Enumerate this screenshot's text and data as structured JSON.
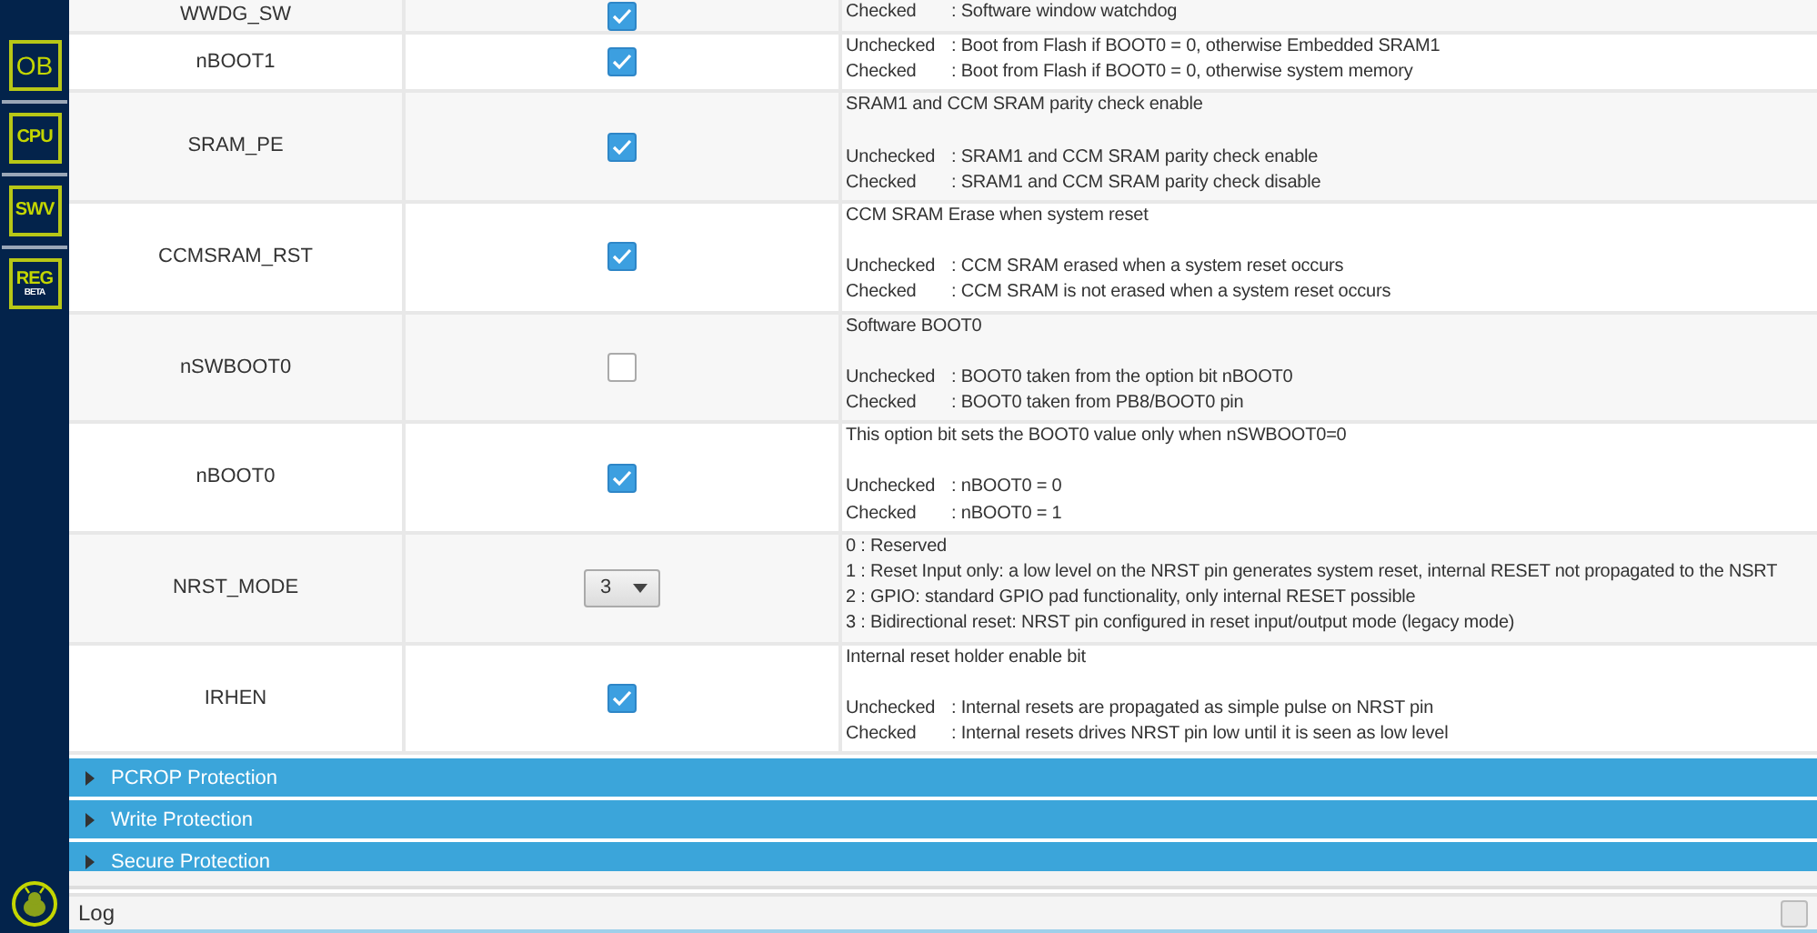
{
  "sidebar": {
    "items": [
      {
        "label": "OB"
      },
      {
        "label": "CPU"
      },
      {
        "label": "SWV"
      },
      {
        "label": "REG",
        "sub": "BETA"
      }
    ]
  },
  "option_bytes": {
    "rows": [
      {
        "name": "WWDG_SW",
        "control": {
          "kind": "checkbox",
          "checked": true
        },
        "options": [
          {
            "key": "Checked",
            "value": ": Software window watchdog"
          }
        ]
      },
      {
        "name": "nBOOT1",
        "control": {
          "kind": "checkbox",
          "checked": true
        },
        "options": [
          {
            "key": "Unchecked",
            "value": ": Boot from Flash if BOOT0 = 0, otherwise Embedded SRAM1"
          },
          {
            "key": "Checked",
            "value": ": Boot from Flash if BOOT0 = 0, otherwise system memory"
          }
        ]
      },
      {
        "name": "SRAM_PE",
        "control": {
          "kind": "checkbox",
          "checked": true
        },
        "title": "SRAM1 and CCM SRAM parity check enable",
        "options": [
          {
            "key": "Unchecked",
            "value": ": SRAM1 and CCM SRAM parity check enable"
          },
          {
            "key": "Checked",
            "value": ": SRAM1 and CCM SRAM parity check disable"
          }
        ]
      },
      {
        "name": "CCMSRAM_RST",
        "control": {
          "kind": "checkbox",
          "checked": true
        },
        "title": "CCM SRAM Erase when system reset",
        "options": [
          {
            "key": "Unchecked",
            "value": ": CCM SRAM erased when a system reset occurs"
          },
          {
            "key": "Checked",
            "value": ": CCM SRAM is not erased when a system reset occurs"
          }
        ]
      },
      {
        "name": "nSWBOOT0",
        "control": {
          "kind": "checkbox",
          "checked": false
        },
        "title": "Software BOOT0",
        "options": [
          {
            "key": "Unchecked",
            "value": ": BOOT0 taken from the option bit nBOOT0"
          },
          {
            "key": "Checked",
            "value": ": BOOT0 taken from PB8/BOOT0 pin"
          }
        ]
      },
      {
        "name": "nBOOT0",
        "control": {
          "kind": "checkbox",
          "checked": true
        },
        "title": "This option bit sets the BOOT0 value only when nSWBOOT0=0",
        "options": [
          {
            "key": "Unchecked",
            "value": ": nBOOT0 = 0"
          },
          {
            "key": "Checked",
            "value": ": nBOOT0 = 1"
          }
        ]
      },
      {
        "name": "NRST_MODE",
        "control": {
          "kind": "select",
          "value": "3"
        },
        "options": [
          {
            "key": "0",
            "value": ": Reserved"
          },
          {
            "key": "1",
            "value": ": Reset Input only: a low level on the NRST pin generates system reset, internal RESET not propagated to the NSRT"
          },
          {
            "key": "2",
            "value": ": GPIO: standard GPIO pad functionality, only internal RESET possible"
          },
          {
            "key": "3",
            "value": ": Bidirectional reset: NRST pin configured in reset input/output mode (legacy mode)"
          }
        ]
      },
      {
        "name": "IRHEN",
        "control": {
          "kind": "checkbox",
          "checked": true
        },
        "title": "Internal reset holder enable bit",
        "options": [
          {
            "key": "Unchecked",
            "value": ": Internal resets are propagated as simple pulse on NRST pin"
          },
          {
            "key": "Checked",
            "value": ": Internal resets drives NRST pin low until it is seen as low level"
          }
        ]
      }
    ]
  },
  "sections": [
    {
      "label": "PCROP Protection",
      "expanded": false
    },
    {
      "label": "Write Protection",
      "expanded": false
    },
    {
      "label": "Secure Protection",
      "expanded": false
    }
  ],
  "log": {
    "title": "Log",
    "checked": false
  }
}
